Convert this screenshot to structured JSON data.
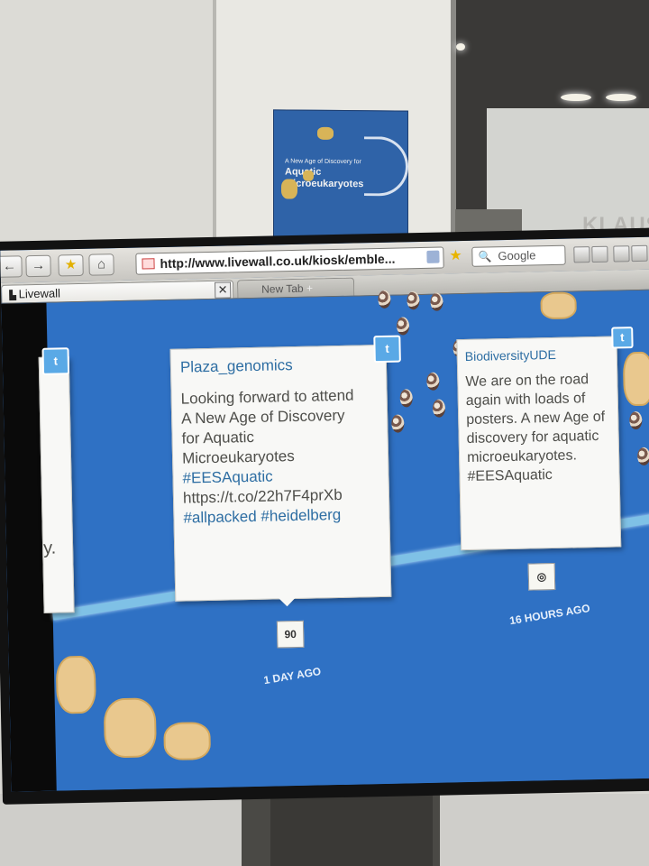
{
  "room": {
    "poster": {
      "line_small": "A New Age of Discovery for",
      "line_title": "Aquatic Microeukaryotes"
    },
    "sign": "KLAUS"
  },
  "browser": {
    "url": "http://www.livewall.co.uk/kiosk/emble...",
    "search_placeholder": "Google",
    "tabs": [
      {
        "label": "Livewall",
        "active": true
      },
      {
        "label": "New Tab",
        "active": false
      }
    ],
    "close_glyph": "✕"
  },
  "feed": {
    "left_card_fragment": "y.",
    "cards": [
      {
        "user": "Plaza_genomics",
        "lines": [
          "Looking forward to attend",
          "A New Age of Discovery",
          "for Aquatic",
          "Microeukaryotes",
          "#EESAquatic",
          "https://t.co/22h7F4prXb",
          "#allpacked #heidelberg"
        ],
        "time": "1 DAY AGO",
        "marker": "90"
      },
      {
        "user": "BiodiversityUDE",
        "lines": [
          "We are on the road",
          "again with loads of",
          "posters. A new Age of",
          "discovery for aquatic",
          "microeukaryotes.",
          "#EESAquatic"
        ],
        "time": "16 HOURS AGO",
        "marker": "◎"
      }
    ],
    "twitter_badge": "t"
  },
  "colors": {
    "screen_blue": "#2f71c4",
    "link_blue": "#2e6ea3",
    "timeline": "#7fc1e6"
  }
}
